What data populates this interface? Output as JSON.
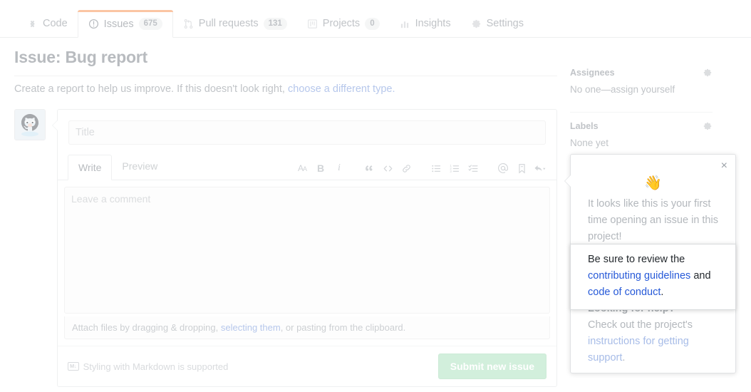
{
  "repo_nav": {
    "tabs": [
      {
        "label": "Code",
        "icon": "code-icon",
        "count": null,
        "selected": false
      },
      {
        "label": "Issues",
        "icon": "issue-opened-icon",
        "count": "675",
        "selected": true
      },
      {
        "label": "Pull requests",
        "icon": "git-pull-request-icon",
        "count": "131",
        "selected": false
      },
      {
        "label": "Projects",
        "icon": "project-board-icon",
        "count": "0",
        "selected": false
      },
      {
        "label": "Insights",
        "icon": "graph-icon",
        "count": null,
        "selected": false
      },
      {
        "label": "Settings",
        "icon": "gear-icon",
        "count": null,
        "selected": false
      }
    ]
  },
  "page": {
    "title": "Issue: Bug report",
    "subtitle_prefix": "Create a report to help us improve. If this doesn't look right, ",
    "subtitle_link": "choose a different type.",
    "accent_color": "#f9a26c",
    "link_color": "#8aa6e0"
  },
  "form": {
    "title_placeholder": "Title",
    "title_value": "",
    "tabs": [
      {
        "label": "Write",
        "active": true
      },
      {
        "label": "Preview",
        "active": false
      }
    ],
    "toolbar": [
      {
        "name": "text-size-icon",
        "glyph": "AA"
      },
      {
        "name": "bold-icon",
        "glyph": "B"
      },
      {
        "name": "italic-icon",
        "glyph": "i"
      },
      {
        "name": "quote-icon",
        "glyph": "“"
      },
      {
        "name": "code-icon",
        "glyph": "<>"
      },
      {
        "name": "link-icon",
        "glyph": "link"
      },
      {
        "name": "unordered-list-icon",
        "glyph": "ul"
      },
      {
        "name": "ordered-list-icon",
        "glyph": "ol"
      },
      {
        "name": "task-list-icon",
        "glyph": "task"
      },
      {
        "name": "mention-icon",
        "glyph": "@"
      },
      {
        "name": "saved-reply-icon",
        "glyph": "bookmark"
      },
      {
        "name": "reply-icon",
        "glyph": "reply"
      }
    ],
    "comment_placeholder": "Leave a comment",
    "comment_value": "",
    "attach_prefix": "Attach files by dragging & dropping, ",
    "attach_link": "selecting them",
    "attach_suffix": ", or pasting from the clipboard.",
    "markdown_badge": "M↓",
    "markdown_note": "Styling with Markdown is supported",
    "submit_label": "Submit new issue",
    "submit_color": "#b8e6c8"
  },
  "sidebar": {
    "sections": [
      {
        "title": "Assignees",
        "value": "No one—assign yourself",
        "gear": "gear-icon"
      },
      {
        "title": "Labels",
        "value": "None yet",
        "gear": "gear-icon"
      }
    ]
  },
  "popover": {
    "close_glyph": "×",
    "emoji": "👋",
    "intro": "It looks like this is your first time opening an issue in this project!",
    "highlight": {
      "prefix": "Be sure to review the ",
      "link1": "contributing guidelines",
      "middle": " and ",
      "link2": "code of conduct",
      "suffix": "."
    },
    "help_title": "Looking for help?",
    "help_prefix": "Check out the project's ",
    "help_link": "instructions for getting support",
    "help_suffix": "."
  }
}
